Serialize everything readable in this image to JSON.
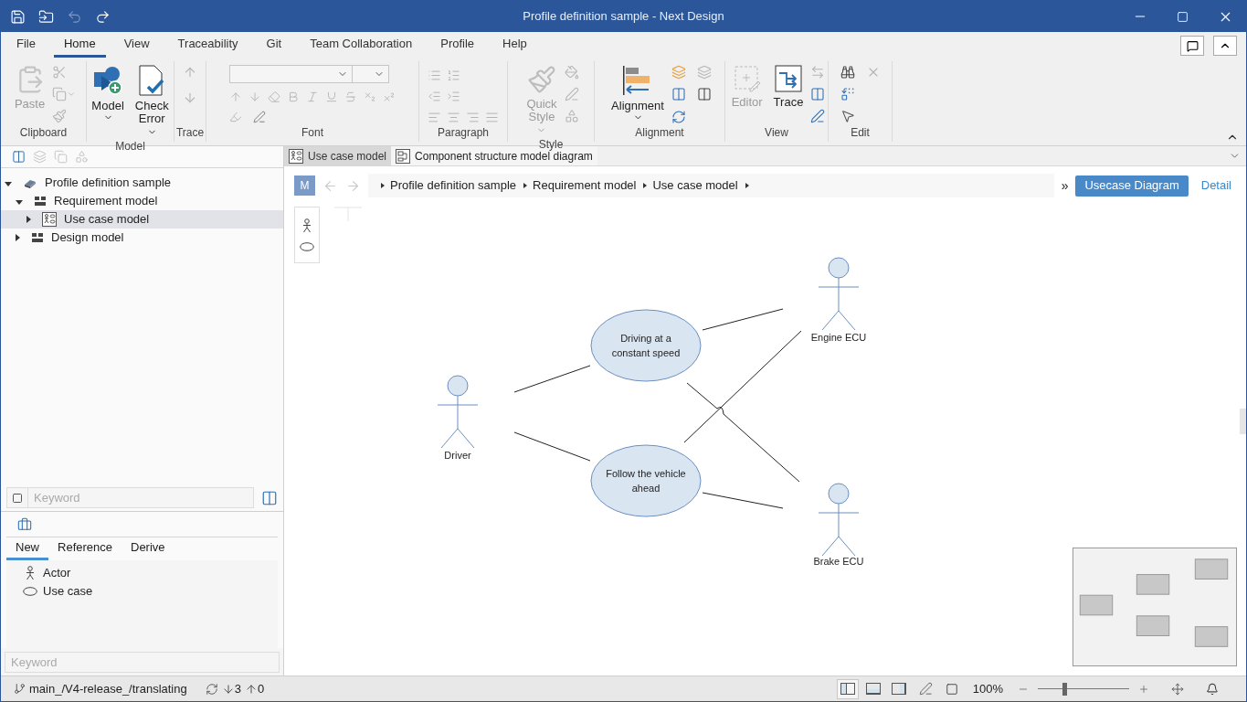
{
  "window": {
    "title": "Profile definition sample - Next Design"
  },
  "menu_tabs": [
    {
      "label": "File",
      "selected": false
    },
    {
      "label": "Home",
      "selected": true
    },
    {
      "label": "View",
      "selected": false
    },
    {
      "label": "Traceability",
      "selected": false
    },
    {
      "label": "Git",
      "selected": false
    },
    {
      "label": "Team Collaboration",
      "selected": false
    },
    {
      "label": "Profile",
      "selected": false
    },
    {
      "label": "Help",
      "selected": false
    }
  ],
  "ribbon": {
    "groups": [
      {
        "label": "Clipboard",
        "buttons": [
          {
            "label": "Paste",
            "kind": "paste",
            "disabled": true,
            "dropdown": false
          }
        ]
      },
      {
        "label": "Model",
        "buttons": [
          {
            "label": "Model",
            "kind": "model",
            "disabled": false,
            "dropdown": true
          },
          {
            "label": "Check Error",
            "kind": "check",
            "disabled": false,
            "dropdown": true
          }
        ]
      },
      {
        "label": "Trace"
      },
      {
        "label": "Font"
      },
      {
        "label": "Paragraph"
      },
      {
        "label": "Style",
        "buttons": [
          {
            "label": "Quick Style",
            "kind": "quickstyle",
            "disabled": true,
            "dropdown": true
          }
        ]
      },
      {
        "label": "Alignment",
        "buttons": [
          {
            "label": "Alignment",
            "kind": "alignment",
            "disabled": false,
            "dropdown": true
          }
        ]
      },
      {
        "label": "View",
        "buttons": [
          {
            "label": "Editor",
            "kind": "editor",
            "disabled": true,
            "dropdown": false
          },
          {
            "label": "Trace",
            "kind": "trace",
            "disabled": false,
            "dropdown": false
          }
        ]
      },
      {
        "label": "Edit"
      }
    ]
  },
  "doc_tabs": [
    {
      "label": "Use case model",
      "kind": "usecase",
      "selected": true
    },
    {
      "label": "Component structure model diagram",
      "kind": "component",
      "selected": false
    }
  ],
  "tree": [
    {
      "label": "Profile definition sample",
      "kind": "project",
      "expanded": true,
      "selected": false,
      "children": [
        {
          "label": "Requirement model",
          "kind": "package",
          "expanded": true,
          "selected": false,
          "children": [
            {
              "label": "Use case model",
              "kind": "diagram",
              "expanded": false,
              "selected": true
            }
          ]
        },
        {
          "label": "Design model",
          "kind": "package",
          "expanded": false,
          "selected": false
        }
      ]
    }
  ],
  "tree_search": {
    "placeholder": "Keyword"
  },
  "toolbox": {
    "tabs": [
      {
        "label": "New",
        "selected": true
      },
      {
        "label": "Reference",
        "selected": false
      },
      {
        "label": "Derive",
        "selected": false
      }
    ],
    "items": [
      {
        "label": "Actor",
        "kind": "actor"
      },
      {
        "label": "Use case",
        "kind": "usecase"
      }
    ],
    "search": {
      "placeholder": "Keyword"
    }
  },
  "editor": {
    "badge": "M",
    "breadcrumb": [
      "Profile definition sample",
      "Requirement model",
      "Use case model"
    ],
    "overflow": "»",
    "view_button": "Usecase Diagram",
    "detail_link": "Detail"
  },
  "diagram": {
    "actors": [
      {
        "name": "Driver"
      },
      {
        "name": "Engine ECU"
      },
      {
        "name": "Brake ECU"
      }
    ],
    "use_cases": [
      {
        "lines": [
          "Driving at a",
          "constant speed"
        ]
      },
      {
        "lines": [
          "Follow the vehicle",
          "ahead"
        ]
      }
    ]
  },
  "status_bar": {
    "branch": "main_/V4-release_/translating",
    "incoming": "3",
    "outgoing": "0",
    "layouts": [
      {
        "kind": "left",
        "selected": true
      },
      {
        "kind": "bottom",
        "selected": false
      },
      {
        "kind": "right",
        "selected": false
      }
    ],
    "zoom": "100%",
    "zoom_slider": {
      "level": 0.27
    }
  }
}
